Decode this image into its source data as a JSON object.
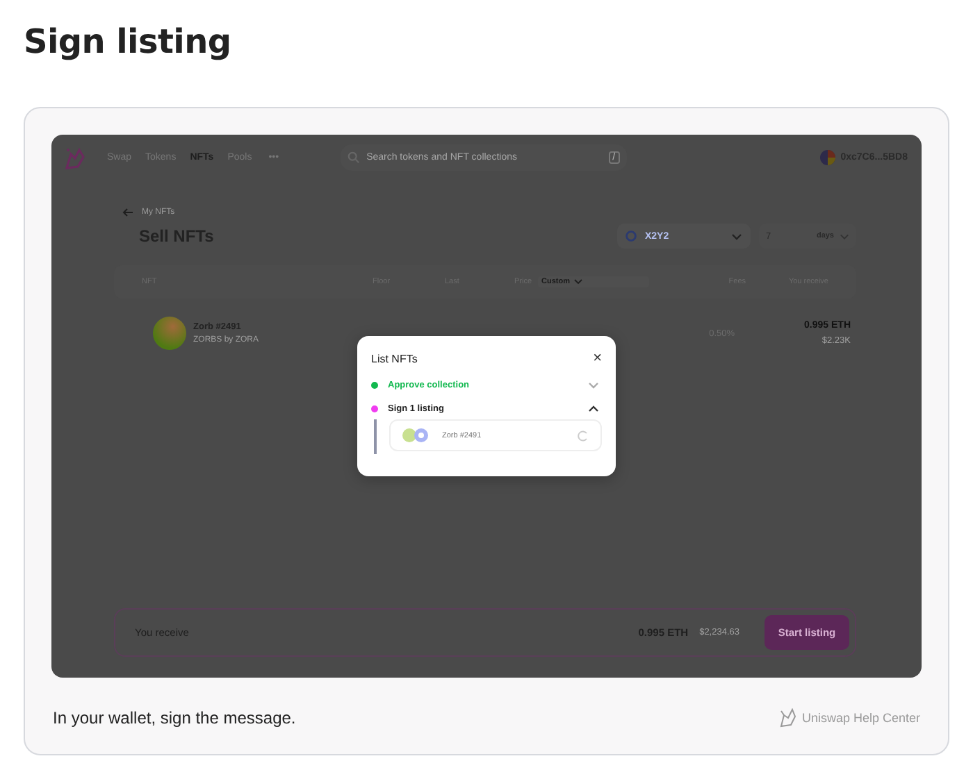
{
  "page_title": "Sign listing",
  "screen": {
    "nav": {
      "items": [
        {
          "label": "Swap",
          "selected": false
        },
        {
          "label": "Tokens",
          "selected": false
        },
        {
          "label": "NFTs",
          "selected": true
        },
        {
          "label": "Pools",
          "selected": false
        }
      ],
      "more": "•••",
      "search_placeholder": "Search tokens and NFT collections",
      "search_shortcut": "/",
      "account": "0xc7C6...5BD8"
    },
    "back_link": "My NFTs",
    "heading": "Sell NFTs",
    "marketplace": "X2Y2",
    "duration_value": "7",
    "duration_unit": "days",
    "table": {
      "columns": [
        {
          "label": "NFT"
        },
        {
          "label": "Floor"
        },
        {
          "label": "Last"
        },
        {
          "label": "Price",
          "dropdown": "Custom"
        },
        {
          "label": "Fees"
        },
        {
          "label": "You receive"
        }
      ],
      "rows": [
        {
          "name": "Zorb #2491",
          "collection": "ZORBS by ZORA",
          "fees": "0.50%",
          "receive_eth": "0.995 ETH",
          "receive_usd": "$2.23K"
        }
      ]
    },
    "footer": {
      "label": "You receive",
      "eth": "0.995 ETH",
      "usd": "$2,234.63",
      "button": "Start listing"
    },
    "modal": {
      "title": "List NFTs",
      "close": "×",
      "steps": [
        {
          "label": "Approve collection",
          "color": "#12b84f",
          "completed": true,
          "expanded": false
        },
        {
          "label": "Sign 1 listing",
          "color": "#f03cf0",
          "completed": false,
          "expanded": true,
          "items": [
            {
              "name": "Zorb #2491"
            }
          ]
        }
      ]
    }
  },
  "caption": "In your wallet, sign the message.",
  "source": "Uniswap Help Center"
}
